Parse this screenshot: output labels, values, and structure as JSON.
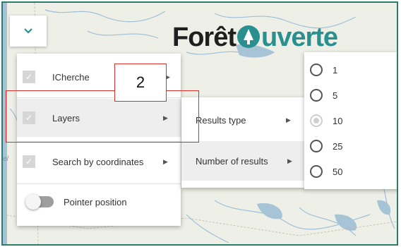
{
  "brand": {
    "prefix": "Forêt",
    "suffix": "uverte"
  },
  "edge_text": "e/",
  "menu1": {
    "items": [
      {
        "label": "ICherche",
        "checked": true
      },
      {
        "label": "Layers",
        "checked": true
      },
      {
        "label": "Search by coordinates",
        "checked": true
      }
    ],
    "toggle_label": "Pointer position"
  },
  "menu2": {
    "items": [
      {
        "label": "Results type"
      },
      {
        "label": "Number of results"
      }
    ]
  },
  "menu3": {
    "options": [
      "1",
      "5",
      "10",
      "25",
      "50"
    ],
    "disabled_option": "10"
  },
  "callout": {
    "number": "2"
  },
  "colors": {
    "frame": "#2e7d6b",
    "callout": "#d9302c",
    "brand_accent": "#2a8f8f",
    "map_water": "#a7c3d6"
  }
}
